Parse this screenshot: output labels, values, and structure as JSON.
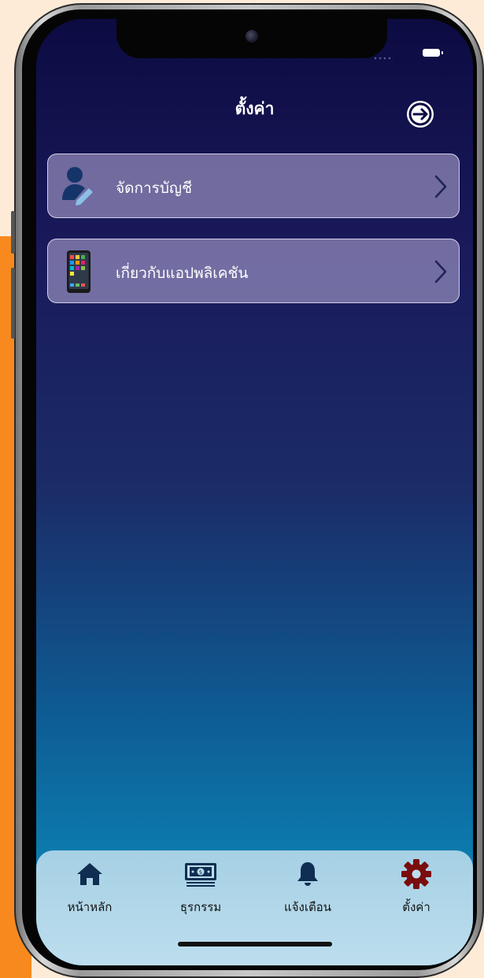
{
  "header": {
    "title": "ตั้งค่า",
    "logout_icon": "logout-arrow-icon"
  },
  "menu": [
    {
      "label": "จัดการบัญชี",
      "icon": "user-edit-icon"
    },
    {
      "label": "เกี่ยวกับแอปพลิเคชัน",
      "icon": "smartphone-apps-icon"
    }
  ],
  "tabbar": {
    "items": [
      {
        "label": "หน้าหลัก",
        "icon": "home-icon",
        "active": false
      },
      {
        "label": "ธุรกรรม",
        "icon": "banknote-icon",
        "active": false
      },
      {
        "label": "แจ้งเตือน",
        "icon": "bell-icon",
        "active": false
      },
      {
        "label": "ตั้งค่า",
        "icon": "gear-icon",
        "active": true
      }
    ]
  },
  "colors": {
    "accent_active_tab": "#7a0d0d",
    "tab_icon": "#0f2e52",
    "background_top": "#0c0b42",
    "background_bottom": "#0c92c2",
    "outer_background": "#fdebd8",
    "orange_accent": "#f7891f"
  }
}
